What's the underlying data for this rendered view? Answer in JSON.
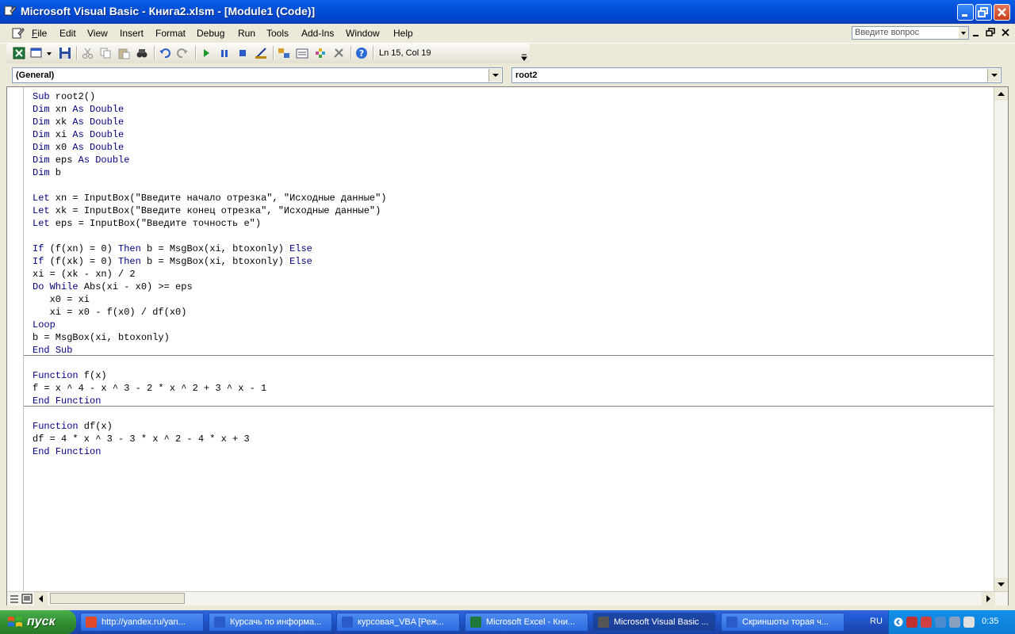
{
  "window": {
    "title": "Microsoft Visual Basic - Книга2.xlsm - [Module1 (Code)]"
  },
  "menu": [
    {
      "label": "File",
      "key": "F"
    },
    {
      "label": "Edit",
      "key": "E"
    },
    {
      "label": "View",
      "key": "V"
    },
    {
      "label": "Insert",
      "key": "I"
    },
    {
      "label": "Format",
      "key": "o"
    },
    {
      "label": "Debug",
      "key": "D"
    },
    {
      "label": "Run",
      "key": "R"
    },
    {
      "label": "Tools",
      "key": "T"
    },
    {
      "label": "Add-Ins",
      "key": "A"
    },
    {
      "label": "Window",
      "key": "W"
    },
    {
      "label": "Help",
      "key": "H"
    }
  ],
  "help_box": {
    "placeholder": "Введите вопрос"
  },
  "toolbar": {
    "position_status": "Ln 15, Col 19"
  },
  "combos": {
    "object": "(General)",
    "procedure": "root2"
  },
  "code_lines": [
    "Sub root2()",
    "Dim xn As Double",
    "Dim xk As Double",
    "Dim xi As Double",
    "Dim x0 As Double",
    "Dim eps As Double",
    "Dim b",
    "",
    "Let xn = InputBox(\"Введите начало отрезка\", \"Исходные данные\")",
    "Let xk = InputBox(\"Введите конец отрезка\", \"Исходные данные\")",
    "Let eps = InputBox(\"Введите точность e\")",
    "",
    "If (f(xn) = 0) Then b = MsgBox(xi, btoxonly) Else",
    "If (f(xk) = 0) Then b = MsgBox(xi, btoxonly) Else",
    "xi = (xk - xn) / 2",
    "Do While Abs(xi - x0) >= eps",
    "   x0 = xi",
    "   xi = x0 - f(x0) / df(x0)",
    "Loop",
    "b = MsgBox(xi, btoxonly)",
    "End Sub",
    "",
    "Function f(x)",
    "f = x ^ 4 - x ^ 3 - 2 * x ^ 2 + 3 ^ x - 1",
    "End Function",
    "",
    "Function df(x)",
    "df = 4 * x ^ 3 - 3 * x ^ 2 - 4 * x + 3",
    "End Function"
  ],
  "taskbar": {
    "start_label": "пуск",
    "tasks": [
      "http://yandex.ru/yan...",
      "Курсачь по информа...",
      "курсовая_VBA [Реж...",
      "Microsoft Excel - Кни...",
      "Microsoft Visual Basic ...",
      "Скриншоты торая ч..."
    ],
    "active_task": 4,
    "language": "RU",
    "clock": "0:35"
  },
  "colors": {
    "keyword": "#00007F",
    "title_bar": "#0453DA",
    "taskbar": "#245EDB",
    "start": "#2E8B2E"
  }
}
